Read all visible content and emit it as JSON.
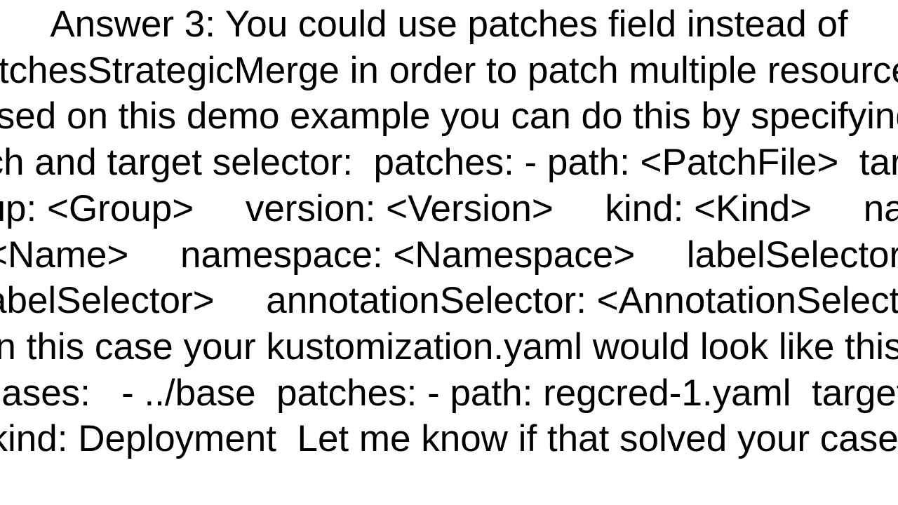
{
  "answer": {
    "text": "Answer 3: You could use patches field instead of patchesStrategicMerge in order to patch multiple resources. Based on this demo example you can do this by specifying a patch and target selector:  patches: - path: <PatchFile>  target:     group: <Group>     version: <Version>     kind: <Kind>     name: <Name>     namespace: <Namespace>     labelSelector: <LabelSelector>     annotationSelector: <AnnotationSelector>  In this case your kustomization.yaml would look like this:  bases:   - ../base  patches: - path: regcred-1.yaml  target:    kind: Deployment  Let me know if that solved your case."
  }
}
